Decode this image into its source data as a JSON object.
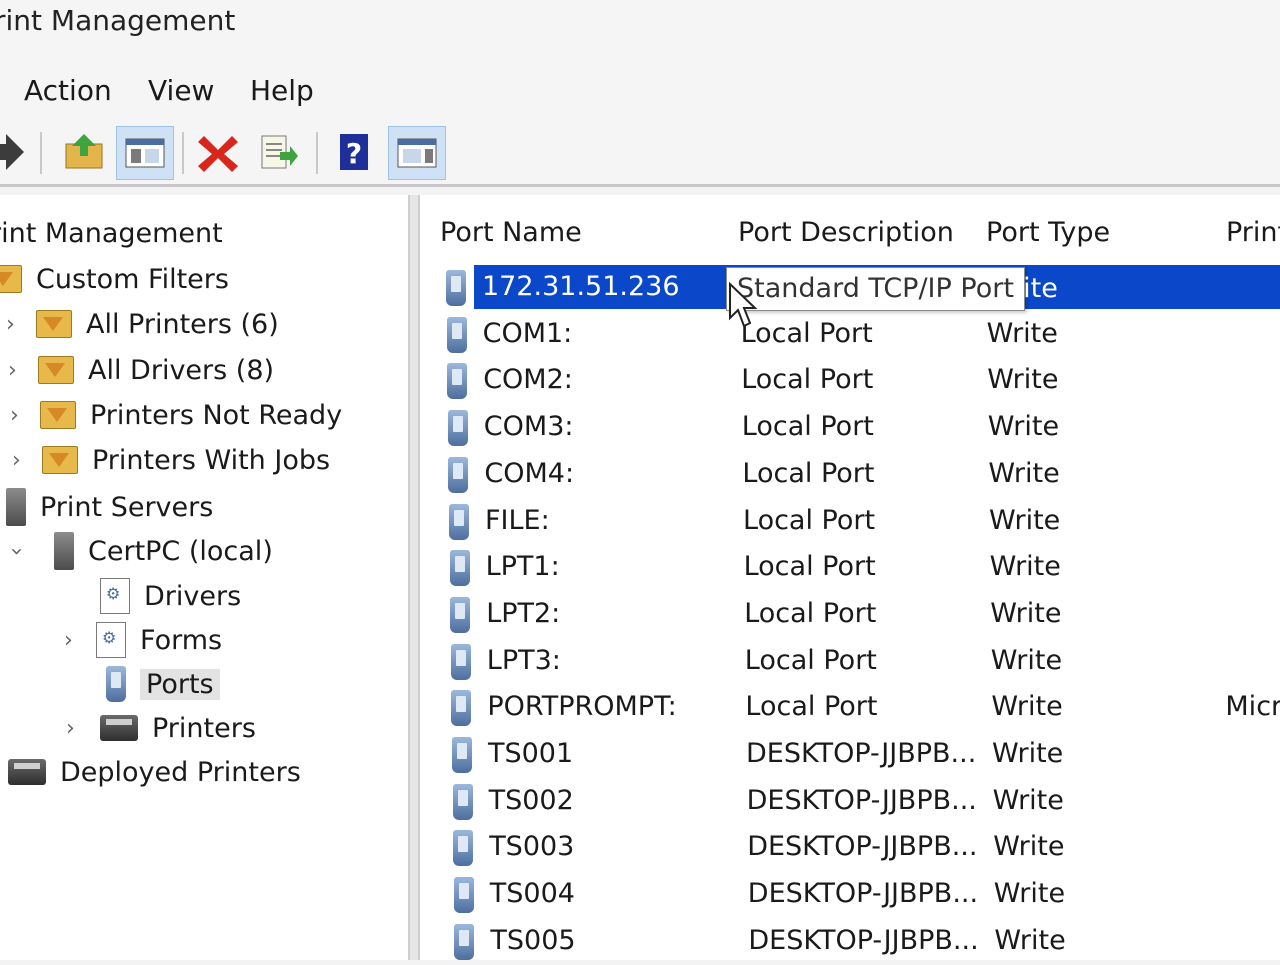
{
  "window": {
    "title": "rint Management"
  },
  "menu": {
    "items": [
      "Action",
      "View",
      "Help"
    ]
  },
  "toolbar": {
    "icons": [
      "forward-arrow-icon",
      "up-folder-icon",
      "show-hide-tree-icon",
      "delete-icon",
      "export-list-icon",
      "help-icon",
      "action-pane-icon"
    ]
  },
  "tree": {
    "root": "rint Management",
    "custom_filters": "Custom Filters",
    "all_printers": "All Printers (6)",
    "all_drivers": "All Drivers (8)",
    "printers_not_ready": "Printers Not Ready",
    "printers_with_jobs": "Printers With Jobs",
    "print_servers": "Print Servers",
    "server": "CertPC (local)",
    "drivers": "Drivers",
    "forms": "Forms",
    "ports": "Ports",
    "printers": "Printers",
    "deployed_printers": "Deployed Printers"
  },
  "list": {
    "columns": [
      "Port Name",
      "Port Description",
      "Port Type",
      "Print"
    ],
    "tooltip": "Standard TCP/IP Port",
    "selected_type_partial": "rite",
    "rows": [
      {
        "name": "172.31.51.236",
        "description": "",
        "type": "",
        "extra": ""
      },
      {
        "name": "COM1:",
        "description": "Local Port",
        "type": "Write",
        "extra": ""
      },
      {
        "name": "COM2:",
        "description": "Local Port",
        "type": "Write",
        "extra": ""
      },
      {
        "name": "COM3:",
        "description": "Local Port",
        "type": "Write",
        "extra": ""
      },
      {
        "name": "COM4:",
        "description": "Local Port",
        "type": "Write",
        "extra": ""
      },
      {
        "name": "FILE:",
        "description": "Local Port",
        "type": "Write",
        "extra": ""
      },
      {
        "name": "LPT1:",
        "description": "Local Port",
        "type": "Write",
        "extra": ""
      },
      {
        "name": "LPT2:",
        "description": "Local Port",
        "type": "Write",
        "extra": ""
      },
      {
        "name": "LPT3:",
        "description": "Local Port",
        "type": "Write",
        "extra": ""
      },
      {
        "name": "PORTPROMPT:",
        "description": "Local Port",
        "type": "Write",
        "extra": "Micr"
      },
      {
        "name": "TS001",
        "description": "DESKTOP-JJBPB...",
        "type": "Write",
        "extra": ""
      },
      {
        "name": "TS002",
        "description": "DESKTOP-JJBPB...",
        "type": "Write",
        "extra": ""
      },
      {
        "name": "TS003",
        "description": "DESKTOP-JJBPB...",
        "type": "Write",
        "extra": ""
      },
      {
        "name": "TS004",
        "description": "DESKTOP-JJBPB...",
        "type": "Write",
        "extra": ""
      },
      {
        "name": "TS005",
        "description": "DESKTOP-JJBPB...",
        "type": "Write",
        "extra": ""
      }
    ]
  },
  "colors": {
    "selection": "#0a47c9",
    "background": "#ffffff",
    "chrome": "#f5f5f5"
  }
}
